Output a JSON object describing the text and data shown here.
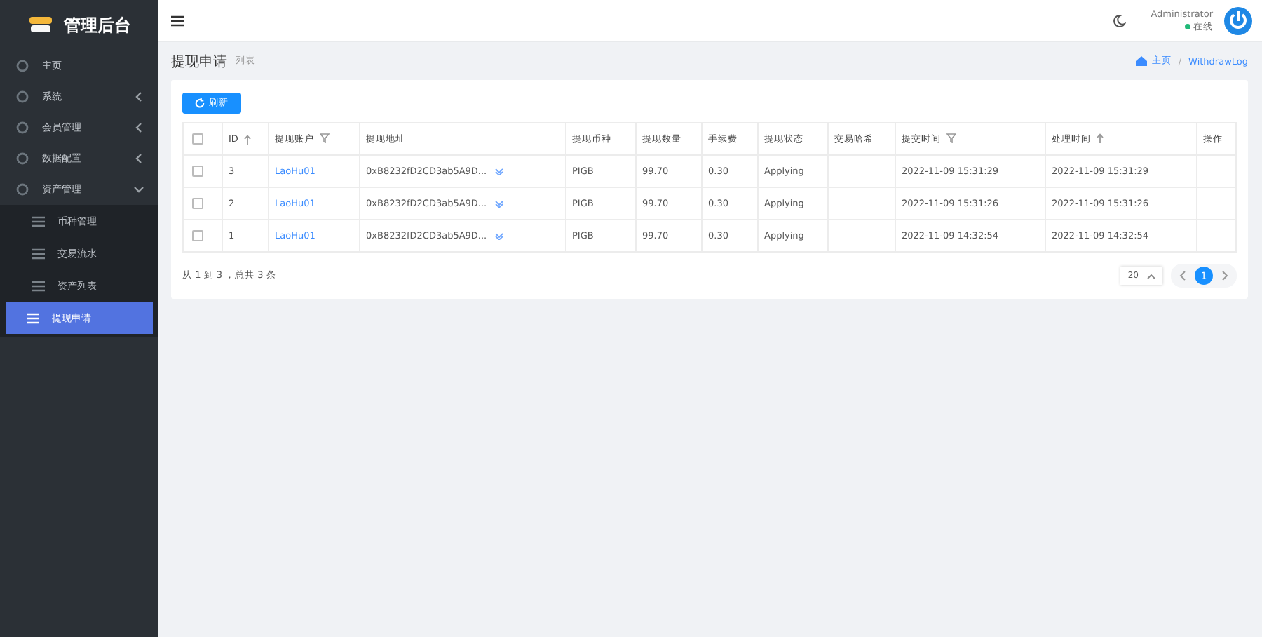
{
  "sidebar": {
    "logo_text": "管理后台",
    "items": [
      {
        "label": "主页",
        "expandable": false,
        "expanded": false,
        "selected": false
      },
      {
        "label": "系统",
        "expandable": true,
        "expanded": false,
        "selected": false
      },
      {
        "label": "会员管理",
        "expandable": true,
        "expanded": false,
        "selected": false
      },
      {
        "label": "数据配置",
        "expandable": true,
        "expanded": false,
        "selected": false
      },
      {
        "label": "资产管理",
        "expandable": true,
        "expanded": true,
        "selected": false,
        "children": [
          {
            "label": "币种管理",
            "selected": false
          },
          {
            "label": "交易流水",
            "selected": false
          },
          {
            "label": "资产列表",
            "selected": false
          },
          {
            "label": "提现申请",
            "selected": true
          }
        ]
      }
    ]
  },
  "header": {
    "user_name": "Administrator",
    "status": {
      "label": "在线",
      "color": "#21b978"
    }
  },
  "page": {
    "title": "提现申请",
    "subtitle": "列表",
    "breadcrumb": [
      "主页",
      "WithdrawLog"
    ],
    "breadcrumb_separator": "/"
  },
  "toolbar": {
    "refresh_button": "刷新"
  },
  "table": {
    "select_all_checked": false,
    "columns": [
      {
        "label": "ID",
        "sortable": true,
        "filterable": false
      },
      {
        "label": "提现账户",
        "sortable": false,
        "filterable": true
      },
      {
        "label": "提现地址",
        "sortable": false,
        "filterable": false
      },
      {
        "label": "提现币种",
        "sortable": false,
        "filterable": false
      },
      {
        "label": "提现数量",
        "sortable": false,
        "filterable": false
      },
      {
        "label": "手续费",
        "sortable": false,
        "filterable": false
      },
      {
        "label": "提现状态",
        "sortable": false,
        "filterable": false
      },
      {
        "label": "交易哈希",
        "sortable": false,
        "filterable": false
      },
      {
        "label": "提交时间",
        "sortable": false,
        "filterable": true
      },
      {
        "label": "处理时间",
        "sortable": true,
        "filterable": false
      },
      {
        "label": "操作",
        "sortable": false,
        "filterable": false
      }
    ],
    "rows": [
      {
        "checked": false,
        "cells": [
          "3",
          "LaoHu01",
          "0xB8232fD2CD3ab5A9D...",
          "PIGB",
          "99.70",
          "0.30",
          "Applying",
          "",
          "2022-11-09 15:31:29",
          "2022-11-09 15:31:29",
          ""
        ]
      },
      {
        "checked": false,
        "cells": [
          "2",
          "LaoHu01",
          "0xB8232fD2CD3ab5A9D...",
          "PIGB",
          "99.70",
          "0.30",
          "Applying",
          "",
          "2022-11-09 15:31:26",
          "2022-11-09 15:31:26",
          ""
        ]
      },
      {
        "checked": false,
        "cells": [
          "1",
          "LaoHu01",
          "0xB8232fD2CD3ab5A9D...",
          "PIGB",
          "99.70",
          "0.30",
          "Applying",
          "",
          "2022-11-09 14:32:54",
          "2022-11-09 14:32:54",
          ""
        ]
      }
    ]
  },
  "footer": {
    "summary": "从 1 到 3 ，总共 3 条",
    "page_size": "20",
    "pages": [
      {
        "label": "1",
        "selected": true
      }
    ]
  }
}
